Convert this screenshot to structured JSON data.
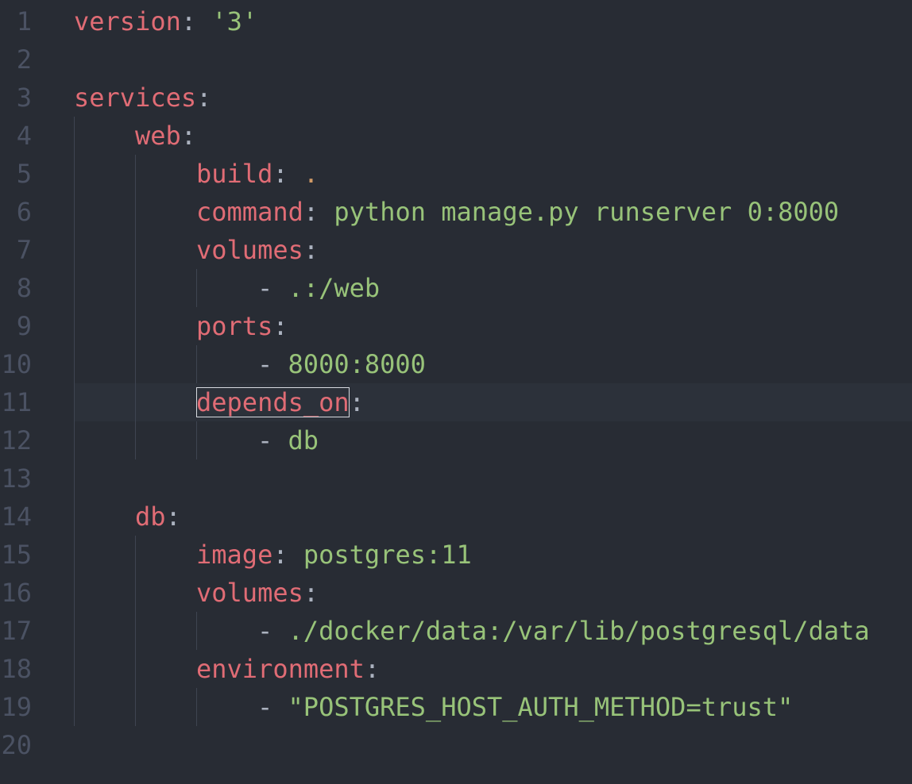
{
  "editor": {
    "line_numbers": [
      "1",
      "2",
      "3",
      "4",
      "5",
      "6",
      "7",
      "8",
      "9",
      "10",
      "11",
      "12",
      "13",
      "14",
      "15",
      "16",
      "17",
      "18",
      "19",
      "20"
    ],
    "lines": [
      {
        "indent": 0,
        "key": "version",
        "colon": ":",
        "sep": " ",
        "value": "'3'",
        "value_type": "string"
      },
      {
        "indent": 0
      },
      {
        "indent": 0,
        "key": "services",
        "colon": ":"
      },
      {
        "indent": 1,
        "key": "web",
        "colon": ":"
      },
      {
        "indent": 2,
        "key": "build",
        "colon": ":",
        "sep": " ",
        "value": ".",
        "value_type": "other"
      },
      {
        "indent": 2,
        "key": "command",
        "colon": ":",
        "sep": " ",
        "value": "python manage.py runserver 0:8000",
        "value_type": "string"
      },
      {
        "indent": 2,
        "key": "volumes",
        "colon": ":"
      },
      {
        "indent": 3,
        "dash": "-",
        "value": ".:/web",
        "value_type": "string"
      },
      {
        "indent": 2,
        "key": "ports",
        "colon": ":"
      },
      {
        "indent": 3,
        "dash": "-",
        "value": "8000:8000",
        "value_type": "string"
      },
      {
        "indent": 2,
        "key": "depends_on",
        "colon": ":",
        "cursor": true
      },
      {
        "indent": 3,
        "dash": "-",
        "value": "db",
        "value_type": "string"
      },
      {
        "indent": 0
      },
      {
        "indent": 1,
        "key": "db",
        "colon": ":"
      },
      {
        "indent": 2,
        "key": "image",
        "colon": ":",
        "sep": " ",
        "value": "postgres:11",
        "value_type": "string"
      },
      {
        "indent": 2,
        "key": "volumes",
        "colon": ":"
      },
      {
        "indent": 3,
        "dash": "-",
        "value": "./docker/data:/var/lib/postgresql/data",
        "value_type": "string"
      },
      {
        "indent": 2,
        "key": "environment",
        "colon": ":"
      },
      {
        "indent": 3,
        "dash": "-",
        "value": "\"POSTGRES_HOST_AUTH_METHOD=trust\"",
        "value_type": "string"
      },
      {
        "indent": 0
      }
    ]
  },
  "colors": {
    "background": "#282c34",
    "current_line": "#2c313a",
    "line_number": "#4b5263",
    "key": "#e06c75",
    "string": "#98c379",
    "number_or_other": "#d19a66",
    "punctuation": "#abb2bf",
    "indent_guide": "#3e4451"
  }
}
